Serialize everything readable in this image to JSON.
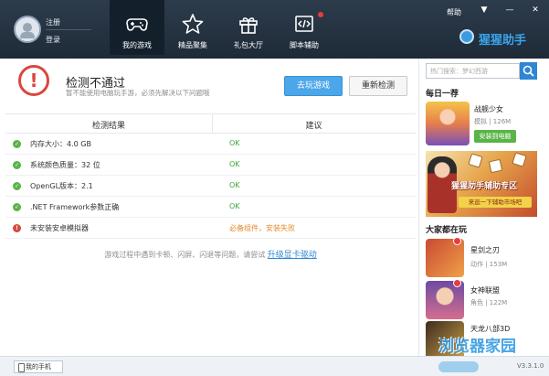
{
  "header": {
    "register": "注册",
    "login": "登录",
    "tabs": [
      {
        "label": "我的游戏",
        "icon": "gamepad-icon"
      },
      {
        "label": "精品聚集",
        "icon": "star-icon"
      },
      {
        "label": "礼包大厅",
        "icon": "gift-icon"
      },
      {
        "label": "脚本辅助",
        "icon": "script-icon"
      }
    ],
    "help": "帮助",
    "brand": "猩猩助手",
    "accent": "#3aa5ee"
  },
  "check": {
    "title": "检测不通过",
    "subtitle": "暂不能使用电脑玩手游，必须先解决以下问题哦",
    "play_button": "去玩游戏",
    "recheck_button": "重新检测",
    "col_result": "检测结果",
    "col_advice": "建议",
    "rows": [
      {
        "label": "内存大小：4.0 GB",
        "status": "OK",
        "state": "ok"
      },
      {
        "label": "系统颜色质量：32 位",
        "status": "OK",
        "state": "ok"
      },
      {
        "label": "OpenGL版本：2.1",
        "status": "OK",
        "state": "ok"
      },
      {
        "label": ".NET Framework参数正确",
        "status": "OK",
        "state": "ok"
      },
      {
        "label": "未安装安卓模拟器",
        "status": "必备组件，安装失败",
        "state": "error"
      }
    ],
    "hint_text": "游戏过程中遇到卡顿、闪屏、闪退等问题，请尝试",
    "hint_link": "升级显卡驱动"
  },
  "sidebar": {
    "search_placeholder": "热门搜索：梦幻西游",
    "daily_title": "每日一荐",
    "daily_game": {
      "name": "战舰少女",
      "meta": "模拟 | 126M",
      "button": "安装到电脑"
    },
    "banner": {
      "title": "猩猩助手辅助专区",
      "cta": "来逛一下辅助市场吧"
    },
    "playing_title": "大家都在玩",
    "playing": [
      {
        "name": "星剑之刃",
        "meta": "动作 | 153M"
      },
      {
        "name": "女神联盟",
        "meta": "角色 | 122M"
      },
      {
        "name": "天龙八部3D",
        "meta": "角色 | 176M"
      }
    ]
  },
  "footer": {
    "my_phone": "我的手机",
    "version": "V3.3.1.0"
  },
  "watermark": "浏览器家园"
}
